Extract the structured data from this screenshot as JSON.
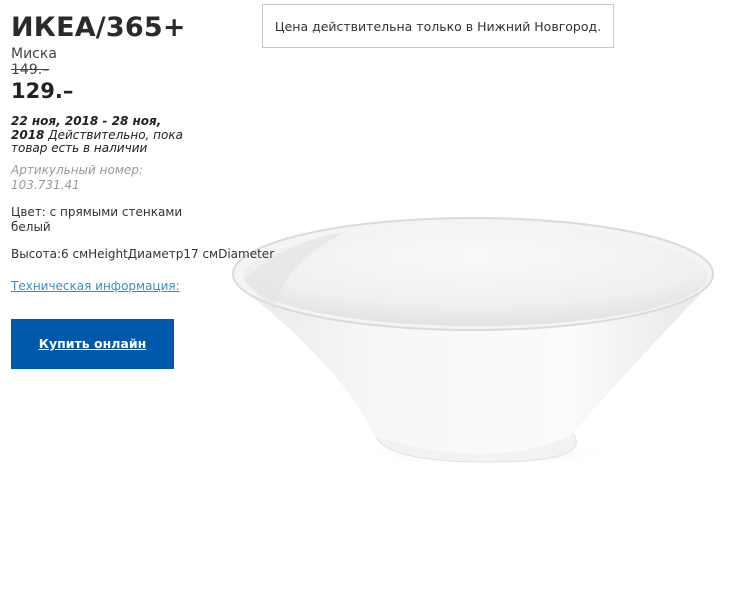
{
  "notice": {
    "text": "Цена действительна только в Нижний Новгород."
  },
  "product": {
    "title": "ИКЕА/365+",
    "subtitle": "Миска",
    "old_price": "149.–",
    "price": "129.–",
    "validity": {
      "dates": "22 ноя, 2018 - 28 ноя, 2018",
      "note": " Действительно, пока товар есть в наличии"
    },
    "article": "Артикульный номер: 103.731.41",
    "color": "Цвет: с прямыми стенками белый",
    "size": "Высота:6 смHeightДиаметр17 смDiameter",
    "tech_link": "Техническая информация:",
    "buy_button": "Купить онлайн",
    "image": {
      "icon": "white-bowl-image",
      "accent_color": "#0058ab"
    }
  }
}
